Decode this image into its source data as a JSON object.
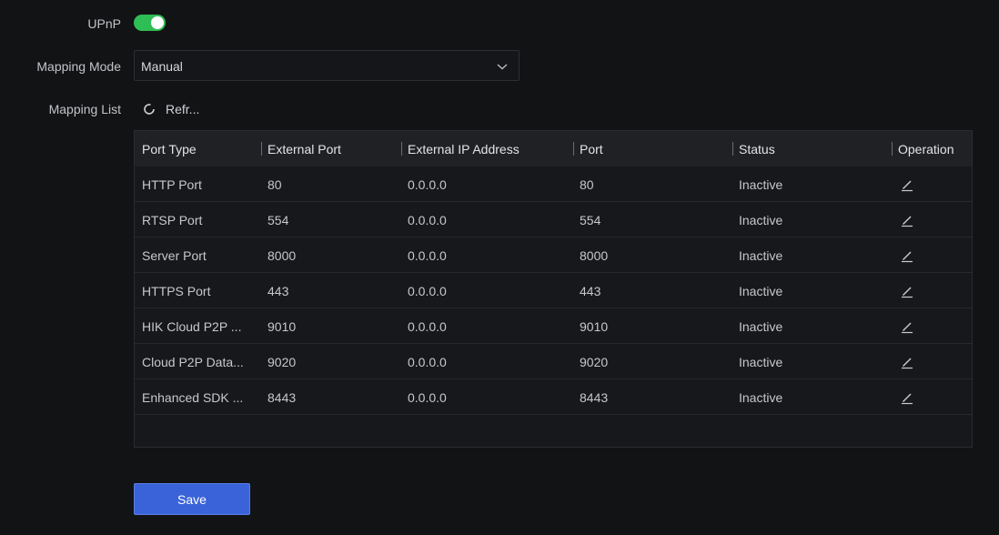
{
  "form": {
    "upnp_label": "UPnP",
    "upnp_enabled": true,
    "mapping_mode_label": "Mapping Mode",
    "mapping_mode_value": "Manual",
    "mapping_list_label": "Mapping List",
    "refresh_label": "Refr..."
  },
  "table": {
    "headers": [
      "Port Type",
      "External Port",
      "External IP Address",
      "Port",
      "Status",
      "Operation"
    ],
    "rows": [
      {
        "port_type": "HTTP Port",
        "external_port": "80",
        "external_ip": "0.0.0.0",
        "port": "80",
        "status": "Inactive"
      },
      {
        "port_type": "RTSP Port",
        "external_port": "554",
        "external_ip": "0.0.0.0",
        "port": "554",
        "status": "Inactive"
      },
      {
        "port_type": "Server Port",
        "external_port": "8000",
        "external_ip": "0.0.0.0",
        "port": "8000",
        "status": "Inactive"
      },
      {
        "port_type": "HTTPS Port",
        "external_port": "443",
        "external_ip": "0.0.0.0",
        "port": "443",
        "status": "Inactive"
      },
      {
        "port_type": "HIK Cloud P2P ...",
        "external_port": "9010",
        "external_ip": "0.0.0.0",
        "port": "9010",
        "status": "Inactive"
      },
      {
        "port_type": "Cloud P2P Data...",
        "external_port": "9020",
        "external_ip": "0.0.0.0",
        "port": "9020",
        "status": "Inactive"
      },
      {
        "port_type": "Enhanced SDK ...",
        "external_port": "8443",
        "external_ip": "0.0.0.0",
        "port": "8443",
        "status": "Inactive"
      }
    ],
    "operation_icon": "edit-pencil-icon"
  },
  "actions": {
    "save_label": "Save"
  },
  "colors": {
    "background": "#121315",
    "toggle_on": "#2fbd55",
    "primary_button": "#3b63d9",
    "table_header": "#1f2125"
  }
}
